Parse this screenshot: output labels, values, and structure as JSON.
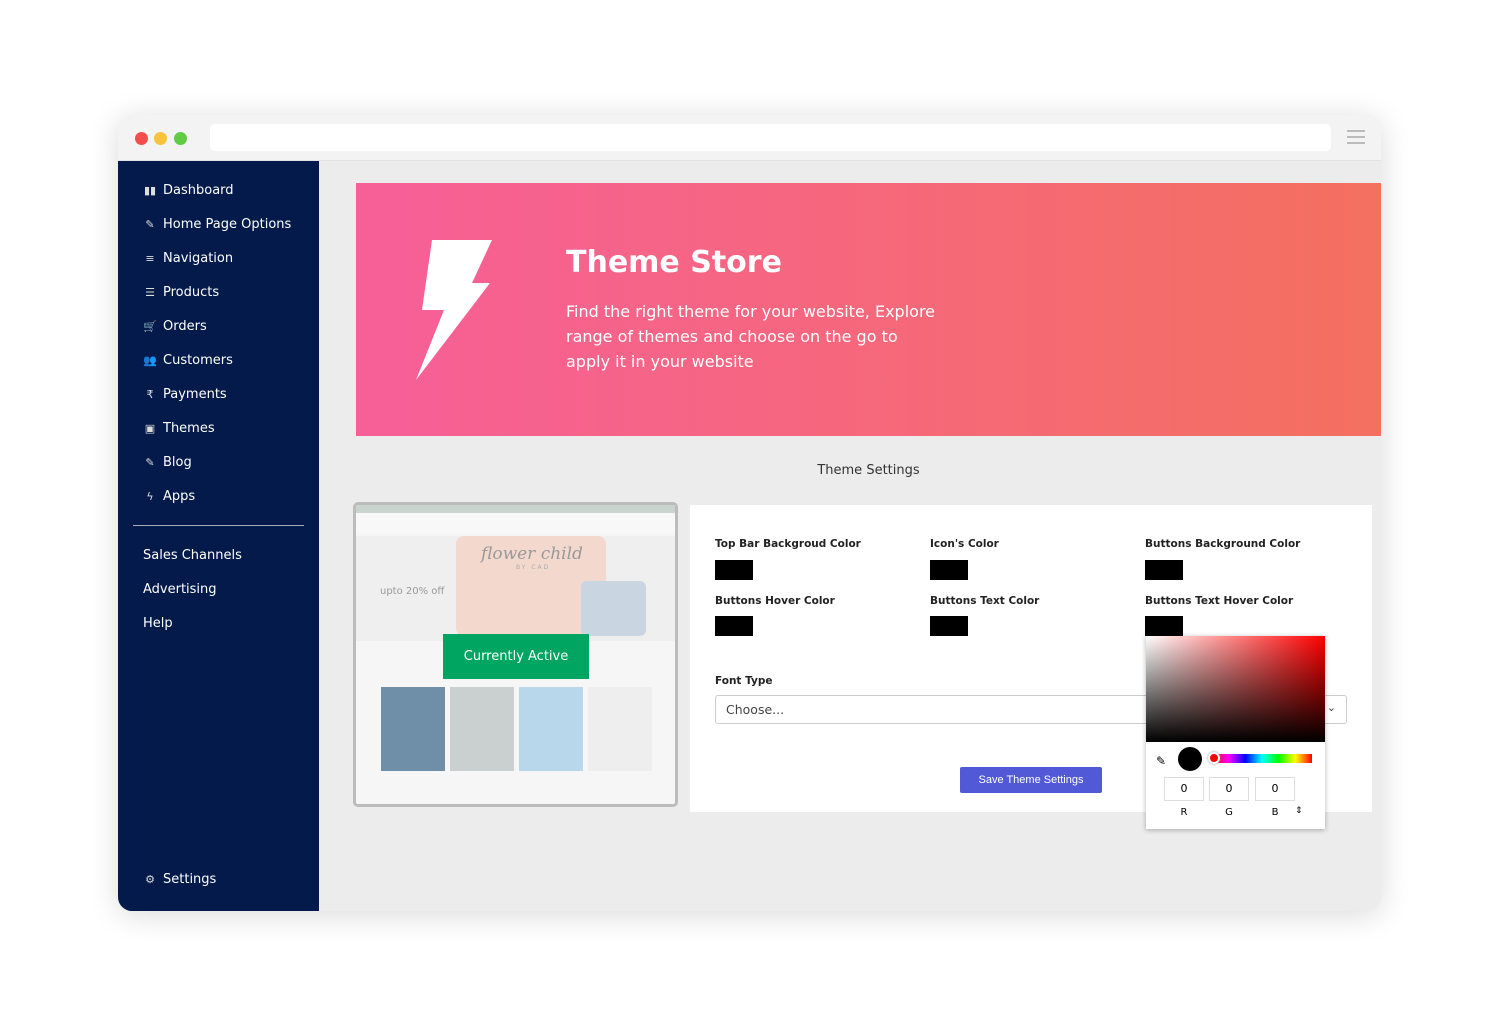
{
  "sidebar": {
    "items": [
      {
        "label": "Dashboard",
        "icon": "dashboard-icon",
        "glyph": "▮▮"
      },
      {
        "label": "Home Page Options",
        "icon": "edit-icon",
        "glyph": "✎"
      },
      {
        "label": "Navigation",
        "icon": "bars-icon",
        "glyph": "≡"
      },
      {
        "label": "Products",
        "icon": "list-icon",
        "glyph": "☰"
      },
      {
        "label": "Orders",
        "icon": "cart-icon",
        "glyph": "🛒"
      },
      {
        "label": "Customers",
        "icon": "users-icon",
        "glyph": "👥"
      },
      {
        "label": "Payments",
        "icon": "rupee-icon",
        "glyph": "₹"
      },
      {
        "label": "Themes",
        "icon": "themes-icon",
        "glyph": "▣"
      },
      {
        "label": "Blog",
        "icon": "edit-icon",
        "glyph": "✎"
      },
      {
        "label": "Apps",
        "icon": "bolt-icon",
        "glyph": "ϟ"
      }
    ],
    "secondary": [
      "Sales Channels",
      "Advertising",
      "Help"
    ],
    "settings": {
      "label": "Settings",
      "glyph": "⚙"
    }
  },
  "banner": {
    "title": "Theme Store",
    "description": "Find the right theme for your website, Explore range of themes and choose on the go to apply it in your website",
    "gradient": [
      "#f75f98",
      "#f4705f"
    ]
  },
  "section_title": "Theme Settings",
  "preview": {
    "badge": "Currently Active",
    "promo": "upto 20% off",
    "brand": "flower child",
    "brand_sub": "BY CAD",
    "badge_color": "#00a562"
  },
  "settings": {
    "colors": [
      {
        "label": "Top Bar Backgroud Color",
        "value": "#000000"
      },
      {
        "label": "Icon's Color",
        "value": "#000000"
      },
      {
        "label": "Buttons Background Color",
        "value": "#000000"
      },
      {
        "label": "Buttons Hover Color",
        "value": "#000000"
      },
      {
        "label": "Buttons Text Color",
        "value": "#000000"
      },
      {
        "label": "Buttons Text Hover Color",
        "value": "#000000"
      }
    ],
    "font_label": "Font Type",
    "font_value": "Choose...",
    "save": "Save Theme Settings"
  },
  "picker": {
    "r": "0",
    "g": "0",
    "b": "0",
    "labels": [
      "R",
      "G",
      "B"
    ],
    "hue": "#ff0000"
  }
}
